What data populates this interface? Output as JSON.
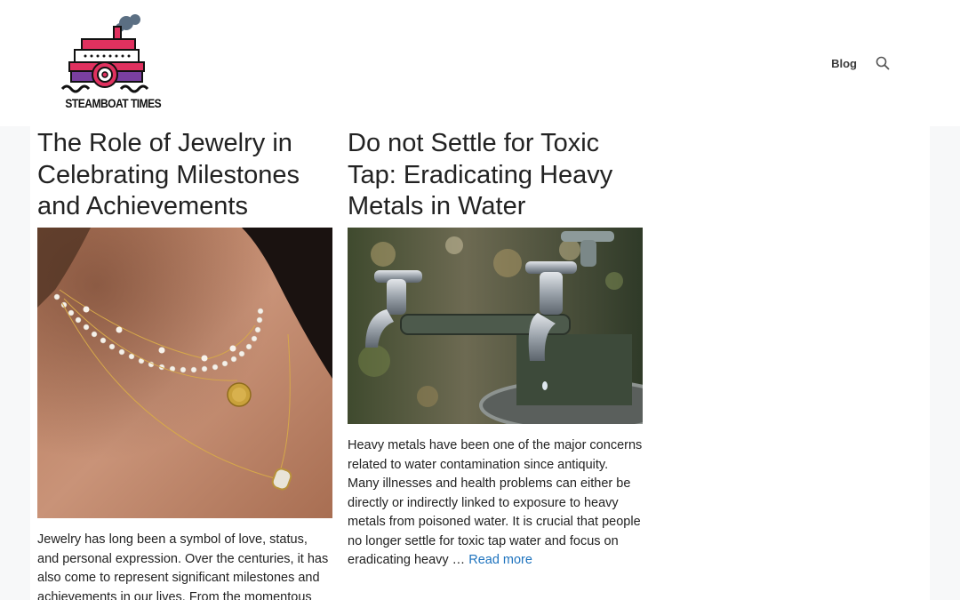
{
  "site": {
    "logo_text": "STEAMBOAT TIMES"
  },
  "nav": {
    "blog_label": "Blog",
    "search_icon": "search-icon"
  },
  "posts": [
    {
      "title": "The Role of Jewelry in Celebrating Milestones and Achievements",
      "image_alt": "Layered gold and pearl necklaces",
      "excerpt": "Jewelry has long been a symbol of love, status, and personal expression. Over the centuries, it has also come to represent significant milestones and achievements in our lives. From the momentous"
    },
    {
      "title": "Do not Settle for Toxic Tap: Eradicating Heavy Metals in Water",
      "image_alt": "Old metal water taps over a fountain basin",
      "excerpt": "Heavy metals have been one of the major concerns related to water contamination since antiquity. Many illnesses and health problems can either be directly or indirectly linked to exposure to heavy metals from poisoned water. It is crucial that people no longer settle for toxic tap water and focus on eradicating heavy …",
      "read_more": "Read more"
    }
  ],
  "colors": {
    "link": "#1e73be",
    "page_background": "#f7f8f9",
    "content_background": "#ffffff"
  }
}
